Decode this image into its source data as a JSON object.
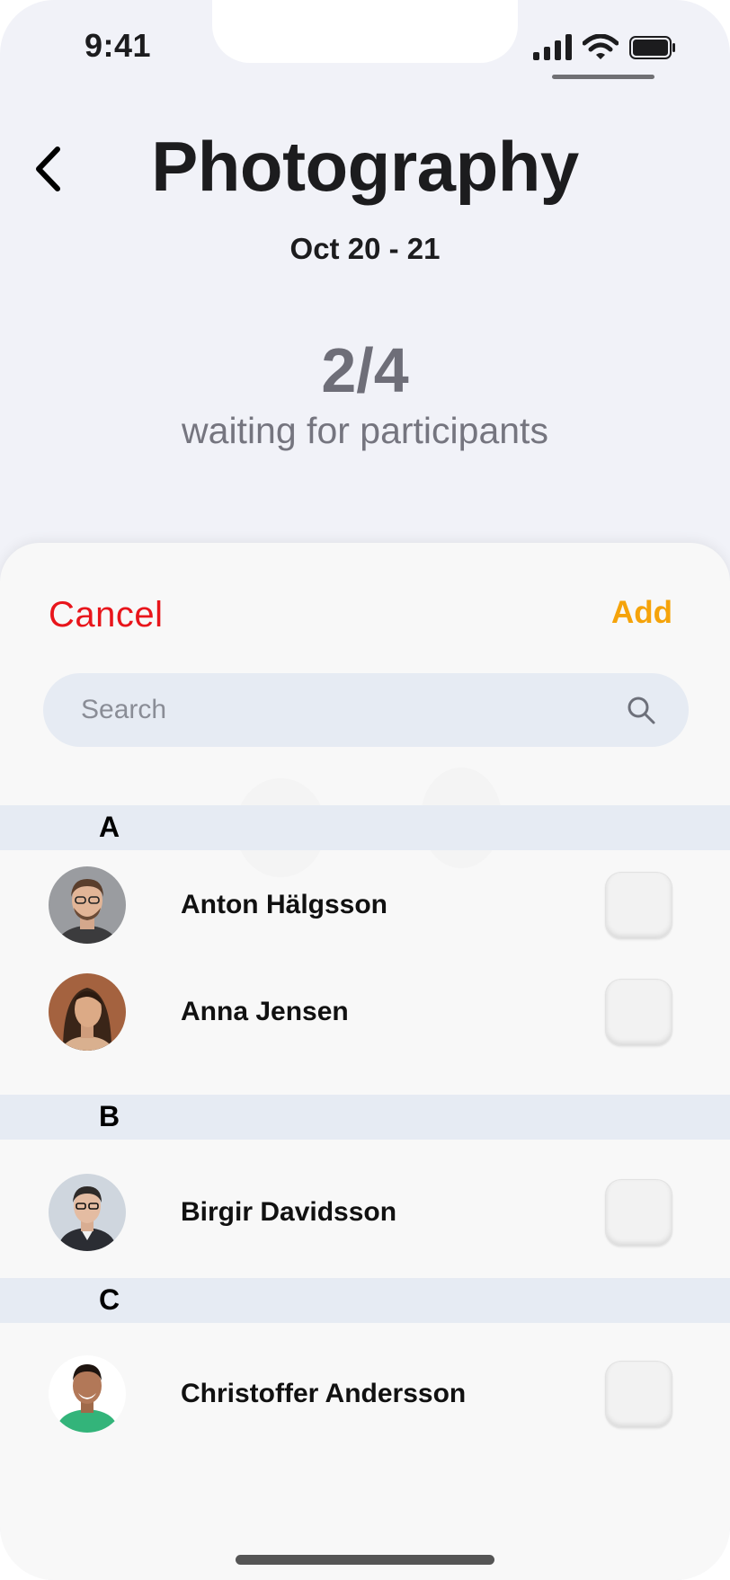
{
  "status_bar": {
    "time": "9:41"
  },
  "header": {
    "title": "Photography",
    "date_range": "Oct 20 - 21",
    "participant_count": "2/4",
    "participant_label": "waiting for participants"
  },
  "sheet": {
    "cancel_label": "Cancel",
    "add_label": "Add",
    "search_placeholder": "Search",
    "sections": [
      {
        "letter": "A",
        "contacts": [
          {
            "name": "Anton Hälgsson",
            "checked": false
          },
          {
            "name": "Anna Jensen",
            "checked": false
          }
        ]
      },
      {
        "letter": "B",
        "contacts": [
          {
            "name": "Birgir Davidsson",
            "checked": false
          }
        ]
      },
      {
        "letter": "C",
        "contacts": [
          {
            "name": "Christoffer Andersson",
            "checked": false
          }
        ]
      }
    ]
  },
  "colors": {
    "cancel": "#e8151b",
    "add": "#f5a30a",
    "section_bg": "#e6ebf3",
    "background": "#f1f2f8"
  },
  "icons": [
    "back-chevron-icon",
    "signal-icon",
    "wifi-icon",
    "battery-icon",
    "search-icon"
  ]
}
